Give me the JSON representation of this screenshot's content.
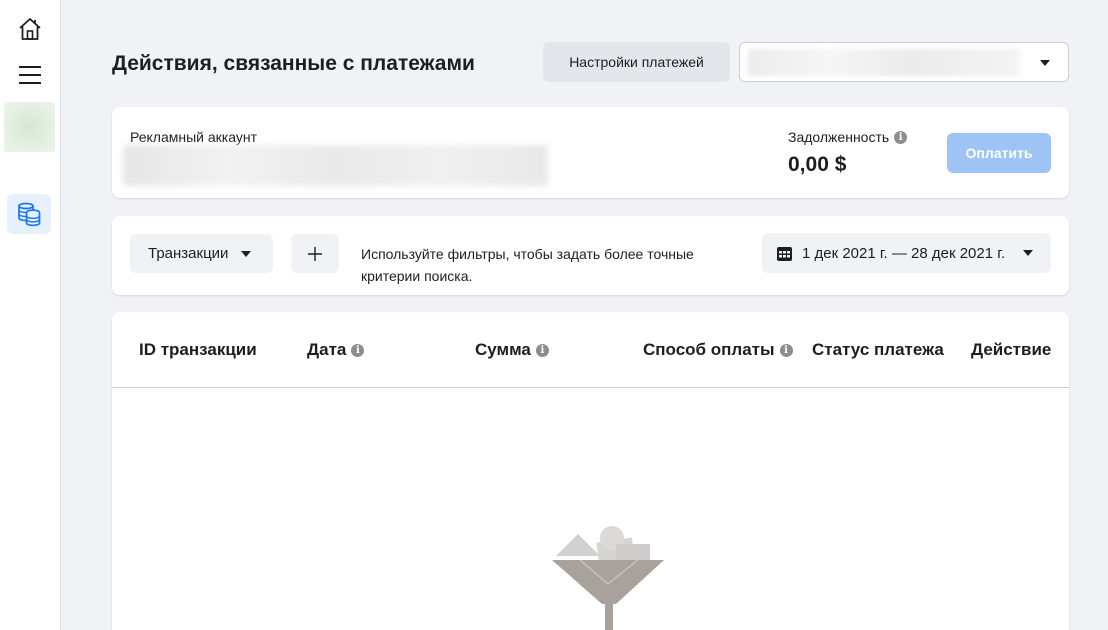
{
  "page": {
    "title": "Действия, связанные с платежами",
    "settings_button": "Настройки платежей"
  },
  "sidebar": {
    "items": [
      {
        "icon": "home-icon"
      },
      {
        "icon": "menu-icon"
      },
      {
        "icon": "avatar"
      },
      {
        "icon": "billing-icon",
        "active": true
      }
    ]
  },
  "account_card": {
    "label": "Рекламный аккаунт",
    "debt_label": "Задолженность",
    "debt_value": "0,00 $",
    "pay_button": "Оплатить"
  },
  "filters": {
    "type_select": "Транзакции",
    "add_filter_symbol": "+",
    "hint": "Используйте фильтры, чтобы задать более точные критерии поиска.",
    "date_range": "1 дек 2021 г. — 28 дек 2021 г."
  },
  "table": {
    "columns": [
      {
        "label": "ID транзакции",
        "info": false
      },
      {
        "label": "Дата",
        "info": true
      },
      {
        "label": "Сумма",
        "info": true
      },
      {
        "label": "Способ оплаты",
        "info": true
      },
      {
        "label": "Статус платежа",
        "info": false
      },
      {
        "label": "Действие",
        "info": false
      }
    ]
  },
  "colors": {
    "accent": "#1877f2",
    "pay_button_disabled": "#9ec3f5",
    "background": "#f0f2f5"
  }
}
